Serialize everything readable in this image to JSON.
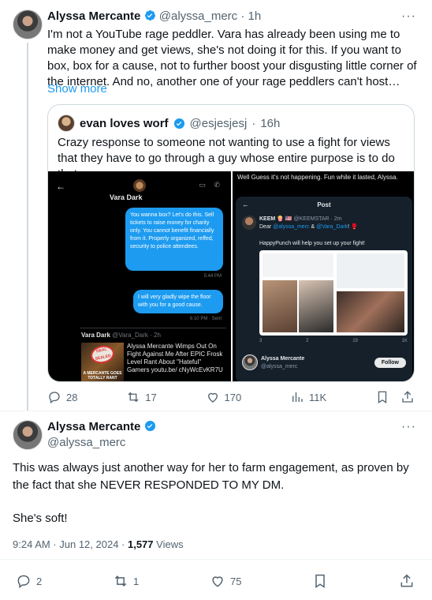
{
  "tweet1": {
    "name": "Alyssa Mercante",
    "handle": "@alyssa_merc",
    "time": "1h",
    "text": "I'm not a YouTube rage peddler. Vara has already been using me to make money and get views, she's not doing it for this. If you want to box, box for a cause, not to further boost your disgusting little corner of the internet. And no, another one of your rage peddlers can't host…",
    "show_more": "Show more",
    "stats": {
      "replies": "28",
      "reposts": "17",
      "likes": "170",
      "views": "11K"
    }
  },
  "quote": {
    "name": "evan loves worf",
    "handle": "@esjesjesj",
    "time": "16h",
    "text": "Crazy response to someone not wanting to use a fight for views that they have to go through a guy whose entire purpose is to do that"
  },
  "dm_screenshot": {
    "back": "←",
    "contact": "Vara Dark",
    "bubble1": "You wanna box? Let's do this. Sell tickets to raise money for charity only. You cannot benefit financially from it. Properly organized, reffed, security to police attendees.",
    "bubble1_time": "5:44 PM",
    "bubble2": "I will very gladly wipe the floor with you for a good cause.",
    "bubble2_time": "6:10 PM · Sent",
    "embed_name": "Vara Dark",
    "embed_handle": "@Vara_Dark · 2h",
    "embed_text": "Alyssa Mercante Wimps Out On Fight Against Me After EPIC Frosk Level Rant About \"Hateful\" Gamers youtu.be/ cNyWcEvKR7U",
    "thumb_stamp": "DEAL SEALED",
    "thumb_caption": "A MERCANTE GOES TOTALLY RANT"
  },
  "post_screenshot": {
    "top_text": "Well Guess it's not happening. Fun while it lasted, Alyssa.",
    "title": "Post",
    "back": "←",
    "keem_name": "KEEM 🍿 🇺🇸",
    "keem_handle": "@KEEMSTAR · 2m",
    "keem_text_dear": "Dear",
    "keem_mention1": "@alyssa_merc",
    "keem_amp": "&",
    "keem_mention2": "@Vara_Dark",
    "keem_text_tail": "! 🥊",
    "happy": "HappyPunch will help you set up your fight!",
    "mini_stats": [
      "3",
      "2",
      "19",
      "1K"
    ],
    "am_name": "Alyssa Mercante",
    "am_handle": "@alyssa_merc",
    "follow": "Follow"
  },
  "tweet2": {
    "name": "Alyssa Mercante",
    "handle": "@alyssa_merc",
    "text": "This was always just another way for her to farm engagement, as proven by the fact that she NEVER RESPONDED TO MY DM.",
    "text2": "She's soft!",
    "timestamp": "9:24 AM · Jun 12, 2024 · ",
    "views_count": "1,577",
    "views_label": " Views",
    "stats": {
      "replies": "2",
      "reposts": "1",
      "likes": "75"
    }
  },
  "icons": [
    "reply-icon",
    "repost-icon",
    "like-icon",
    "views-icon",
    "bookmark-icon",
    "share-icon",
    "more-icon",
    "verified-badge-icon"
  ],
  "colors": {
    "accent": "#1d9bf0",
    "muted": "#536471",
    "text": "#0f1419",
    "border": "#cfd9de"
  }
}
